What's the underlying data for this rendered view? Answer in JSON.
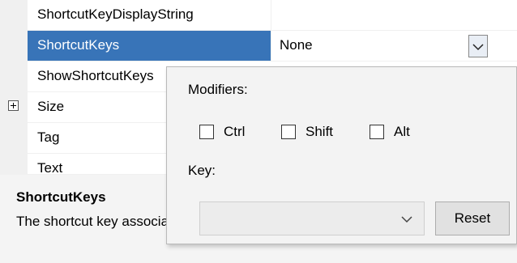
{
  "properties": {
    "rows": [
      {
        "name": "ShortcutKeyDisplayString",
        "value": ""
      },
      {
        "name": "ShortcutKeys",
        "value": "None"
      },
      {
        "name": "ShowShortcutKeys",
        "value": ""
      },
      {
        "name": "Size",
        "value": ""
      },
      {
        "name": "Tag",
        "value": ""
      },
      {
        "name": "Text",
        "value": ""
      }
    ],
    "selected_index": 1
  },
  "description": {
    "title": "ShortcutKeys",
    "text": "The shortcut key associated with the menu item."
  },
  "editor": {
    "modifiers_label": "Modifiers:",
    "ctrl_label": "Ctrl",
    "shift_label": "Shift",
    "alt_label": "Alt",
    "key_label": "Key:",
    "key_value": "",
    "reset_label": "Reset",
    "checks": {
      "ctrl": false,
      "shift": false,
      "alt": false
    }
  },
  "colors": {
    "selection": "#3874b8",
    "gutter": "#f0f0f0",
    "popup_bg": "#f3f3f3"
  },
  "icons": {
    "dropdown": "chevron-down-icon",
    "expand": "plus-box-icon"
  }
}
